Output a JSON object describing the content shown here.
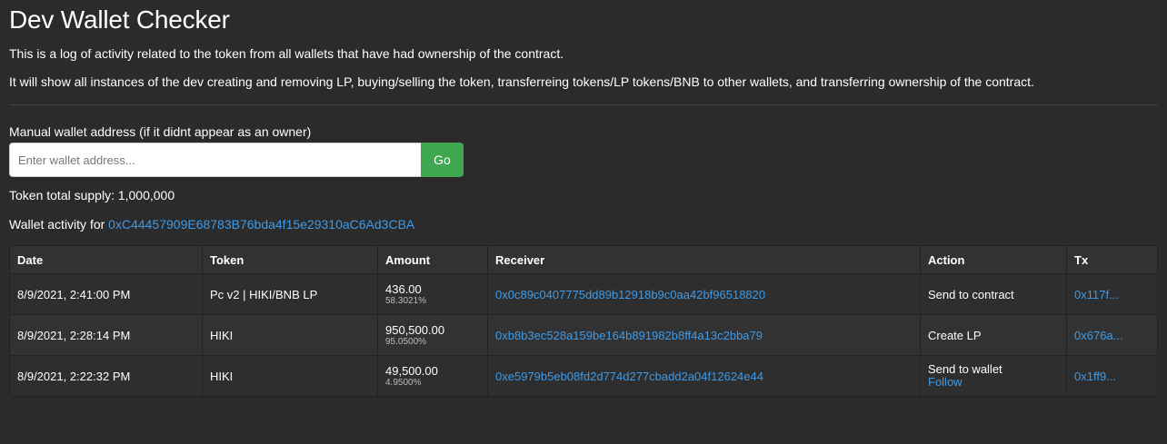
{
  "header": {
    "title": "Dev Wallet Checker",
    "description_1": "This is a log of activity related to the token from all wallets that have had ownership of the contract.",
    "description_2": "It will show all instances of the dev creating and removing LP, buying/selling the token, transferreing tokens/LP tokens/BNB to other wallets, and transferring ownership of the contract."
  },
  "manual": {
    "label": "Manual wallet address (if it didnt appear as an owner)",
    "placeholder": "Enter wallet address...",
    "value": "",
    "go_label": "Go"
  },
  "supply": {
    "text": "Token total supply: 1,000,000"
  },
  "wallet": {
    "prefix": "Wallet activity for",
    "address": "0xC44457909E68783B76bda4f15e29310aC6Ad3CBA"
  },
  "table": {
    "headers": [
      "Date",
      "Token",
      "Amount",
      "Receiver",
      "Action",
      "Tx"
    ],
    "rows": [
      {
        "date": "8/9/2021, 2:41:00 PM",
        "token": "Pc v2 | HIKI/BNB LP",
        "amount": "436.00",
        "percent": "58.3021%",
        "receiver": "0x0c89c0407775dd89b12918b9c0aa42bf96518820",
        "action": "Send to contract",
        "action_link": "",
        "tx": "0x117f..."
      },
      {
        "date": "8/9/2021, 2:28:14 PM",
        "token": "HIKI",
        "amount": "950,500.00",
        "percent": "95.0500%",
        "receiver": "0xb8b3ec528a159be164b891982b8ff4a13c2bba79",
        "action": "Create LP",
        "action_link": "",
        "tx": "0x676a..."
      },
      {
        "date": "8/9/2021, 2:22:32 PM",
        "token": "HIKI",
        "amount": "49,500.00",
        "percent": "4.9500%",
        "receiver": "0xe5979b5eb08fd2d774d277cbadd2a04f12624e44",
        "action": "Send to wallet",
        "action_link": "Follow",
        "tx": "0x1ff9..."
      }
    ]
  },
  "colors": {
    "background": "#2b2b2b",
    "link": "#3d9be9",
    "go_button": "#3ea74f"
  }
}
